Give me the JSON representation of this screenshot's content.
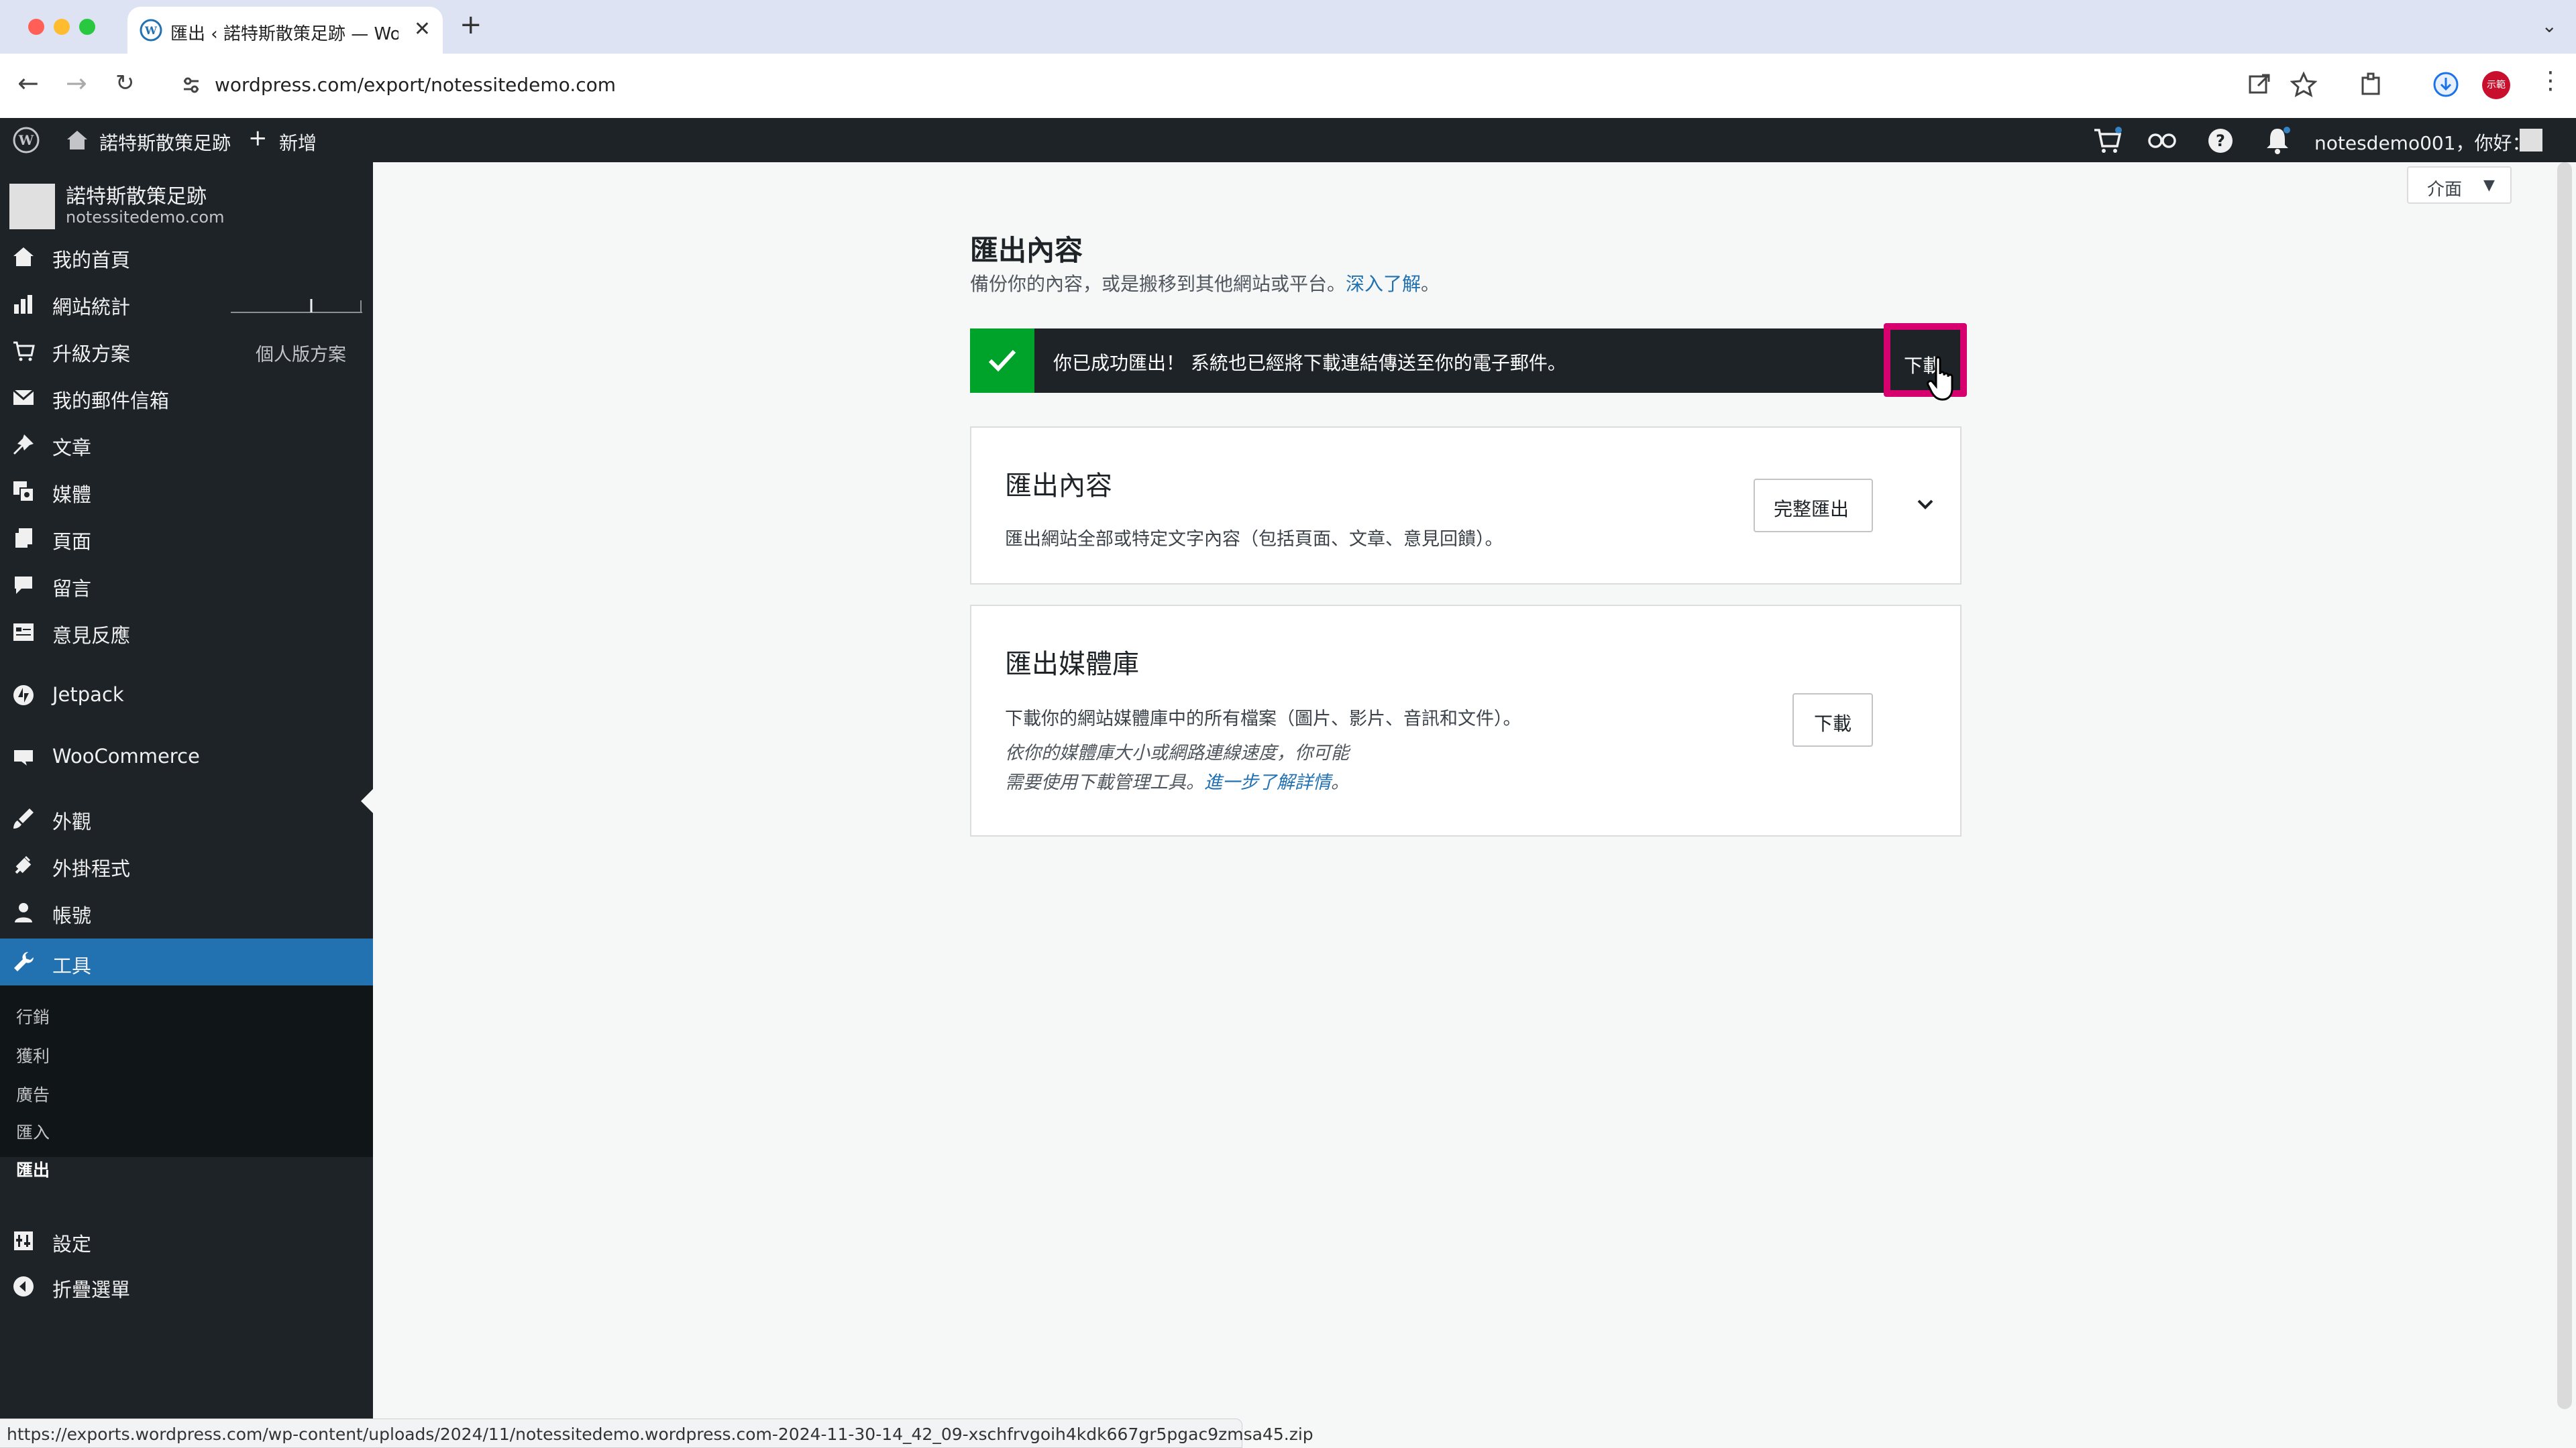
{
  "browser": {
    "tab_title": "匯出 ‹ 諾特斯散策足跡 — Word",
    "url": "wordpress.com/export/notessitedemo.com",
    "profile_text": "示範"
  },
  "adminbar": {
    "site_name": "諾特斯散策足跡",
    "new_label": "新增",
    "greeting": "notesdemo001，你好："
  },
  "sidebar": {
    "site_name": "諾特斯散策足跡",
    "site_domain": "notessitedemo.com",
    "items": [
      {
        "label": "我的首頁",
        "icon": "home-icon"
      },
      {
        "label": "網站統計",
        "icon": "stats-icon"
      },
      {
        "label": "升級方案",
        "icon": "cart-icon",
        "right": "個人版方案"
      },
      {
        "label": "我的郵件信箱",
        "icon": "mail-icon"
      },
      {
        "label": "文章",
        "icon": "pin-icon"
      },
      {
        "label": "媒體",
        "icon": "media-icon"
      },
      {
        "label": "頁面",
        "icon": "pages-icon"
      },
      {
        "label": "留言",
        "icon": "comment-icon"
      },
      {
        "label": "意見反應",
        "icon": "feedback-icon"
      },
      {
        "label": "Jetpack",
        "icon": "jetpack-icon"
      },
      {
        "label": "WooCommerce",
        "icon": "woo-icon"
      },
      {
        "label": "外觀",
        "icon": "brush-icon"
      },
      {
        "label": "外掛程式",
        "icon": "plugin-icon"
      },
      {
        "label": "帳號",
        "icon": "user-icon"
      },
      {
        "label": "工具",
        "icon": "wrench-icon"
      },
      {
        "label": "設定",
        "icon": "settings-icon"
      },
      {
        "label": "折疊選單",
        "icon": "collapse-icon"
      }
    ],
    "submenu": [
      "行銷",
      "獲利",
      "廣告",
      "匯入",
      "匯出"
    ]
  },
  "view_button": "介面",
  "page": {
    "title": "匯出內容",
    "subtitle": "備份你的內容，或是搬移到其他網站或平台。",
    "learn_more": "深入了解",
    "subtitle_end": "。"
  },
  "notice": {
    "message": "你已成功匯出！ 系統也已經將下載連結傳送至你的電子郵件。",
    "download": "下載"
  },
  "card_export": {
    "title": "匯出內容",
    "desc": "匯出網站全部或特定文字內容（包括頁面、文章、意見回饋）。",
    "button": "完整匯出"
  },
  "card_media": {
    "title": "匯出媒體庫",
    "desc": "下載你的網站媒體庫中的所有檔案（圖片、影片、音訊和文件）。",
    "note_line1": "依你的媒體庫大小或網路連線速度，你可能",
    "note_line2": "需要使用下載管理工具。",
    "note_link": "進一步了解詳情",
    "note_end": "。",
    "button": "下載"
  },
  "status_url": "https://exports.wordpress.com/wp-content/uploads/2024/11/notessitedemo.wordpress.com-2024-11-30-14_42_09-xschfrvgoih4kdk667gr5pgac9zmsa45.zip",
  "colors": {
    "accent": "#2271b1",
    "success": "#00a32a",
    "highlight": "#d6006e",
    "admin_dark": "#1d2327"
  }
}
